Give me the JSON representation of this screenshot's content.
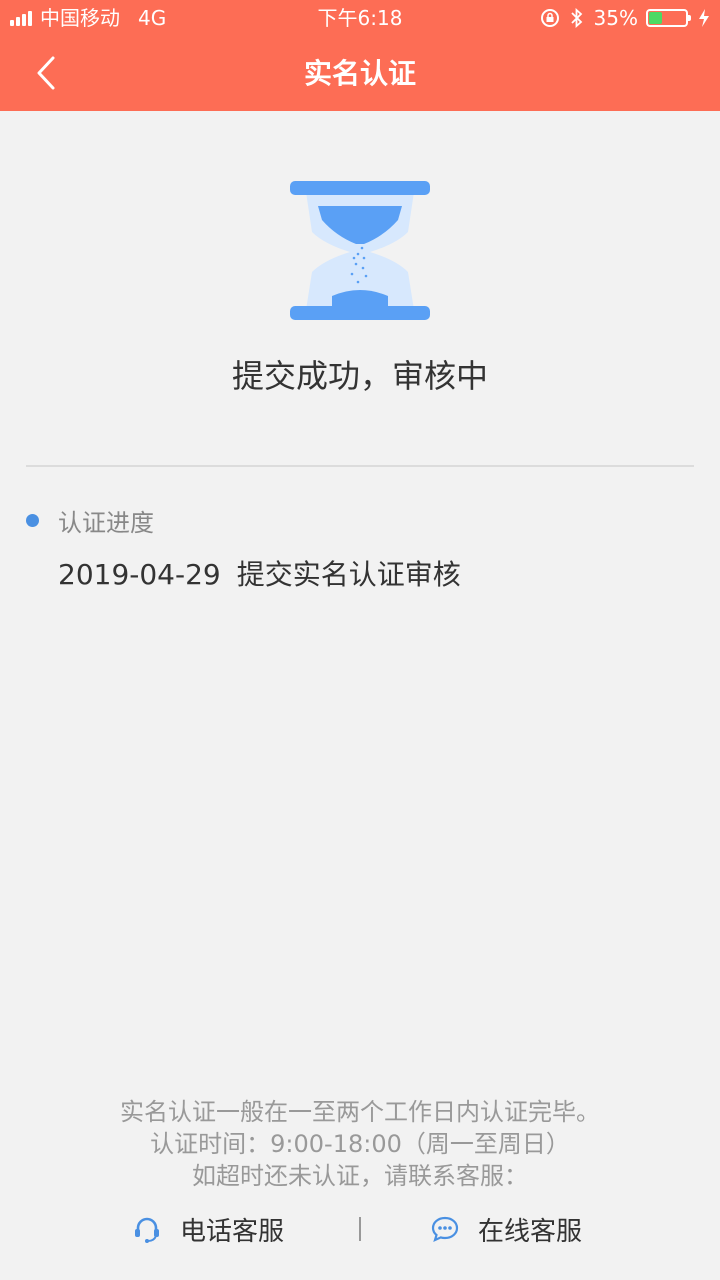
{
  "status_bar": {
    "carrier": "中国移动",
    "network": "4G",
    "time": "下午6:18",
    "battery_text": "35%",
    "battery_level": 0.35,
    "icons": [
      "signal-icon",
      "rotation-lock-icon",
      "bluetooth-icon",
      "battery-icon",
      "charging-icon"
    ]
  },
  "nav": {
    "title": "实名认证",
    "back_icon": "chevron-left-icon"
  },
  "result": {
    "icon": "hourglass-icon",
    "title": "提交成功，审核中"
  },
  "progress": {
    "label": "认证进度",
    "entries": [
      {
        "date": "2019-04-29",
        "text": "提交实名认证审核"
      }
    ]
  },
  "footer": {
    "lines": [
      "实名认证一般在一至两个工作日内认证完毕。",
      "认证时间：9:00-18:00（周一至周日）",
      "如超时还未认证，请联系客服："
    ],
    "phone_service": "电话客服",
    "online_service": "在线客服"
  },
  "colors": {
    "header_bg": "#fd6d55",
    "page_bg": "#f2f2f2",
    "accent_blue": "#4a90e2",
    "hourglass_blue": "#5aa0f5",
    "hourglass_light": "#d7e8fd"
  }
}
